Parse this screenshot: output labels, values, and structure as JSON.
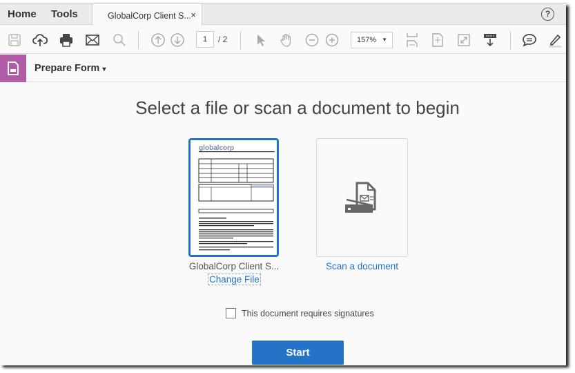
{
  "tabs": {
    "home": "Home",
    "tools": "Tools",
    "document": "GlobalCorp Client S...",
    "close": "×",
    "help": "?"
  },
  "toolbar": {
    "page_current": "1",
    "page_total": "/ 2",
    "zoom": "157%"
  },
  "form_bar": {
    "title": "Prepare Form",
    "caret": "▾",
    "accent": "#b15aa6"
  },
  "main": {
    "heading": "Select a file or scan a document to begin",
    "file_name": "GlobalCorp Client S...",
    "change_file": "Change File",
    "scan_label": "Scan a document",
    "thumbnail_logo": "globalcorp",
    "signatures_label": "This document requires signatures",
    "signatures_checked": false,
    "start": "Start"
  },
  "colors": {
    "primary": "#2473c9",
    "accent": "#b15aa6"
  }
}
